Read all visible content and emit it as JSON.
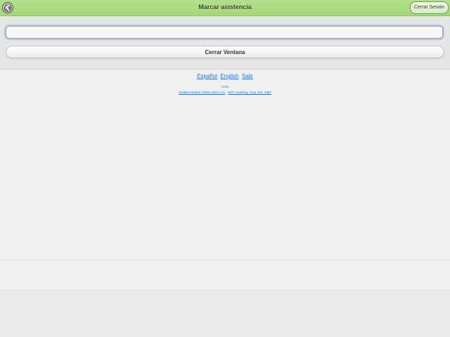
{
  "header": {
    "title": "Marcar asistencia",
    "back_icon": "arrow-left-icon",
    "logout_label": "Cerrar Sesión",
    "accent_color": "#a6d77b"
  },
  "form": {
    "input_value": "",
    "close_window_label": "Cerrar Ventana"
  },
  "footer": {
    "languages": [
      "Español",
      "English"
    ],
    "exit_label": "Salir",
    "version_text": "LPHE",
    "copyright_left": "Grades Gordon ©2021 EDT, LLC",
    "copyright_sep": " - ",
    "copyright_right": "EDT Learning, Corp. Est. 1997"
  }
}
